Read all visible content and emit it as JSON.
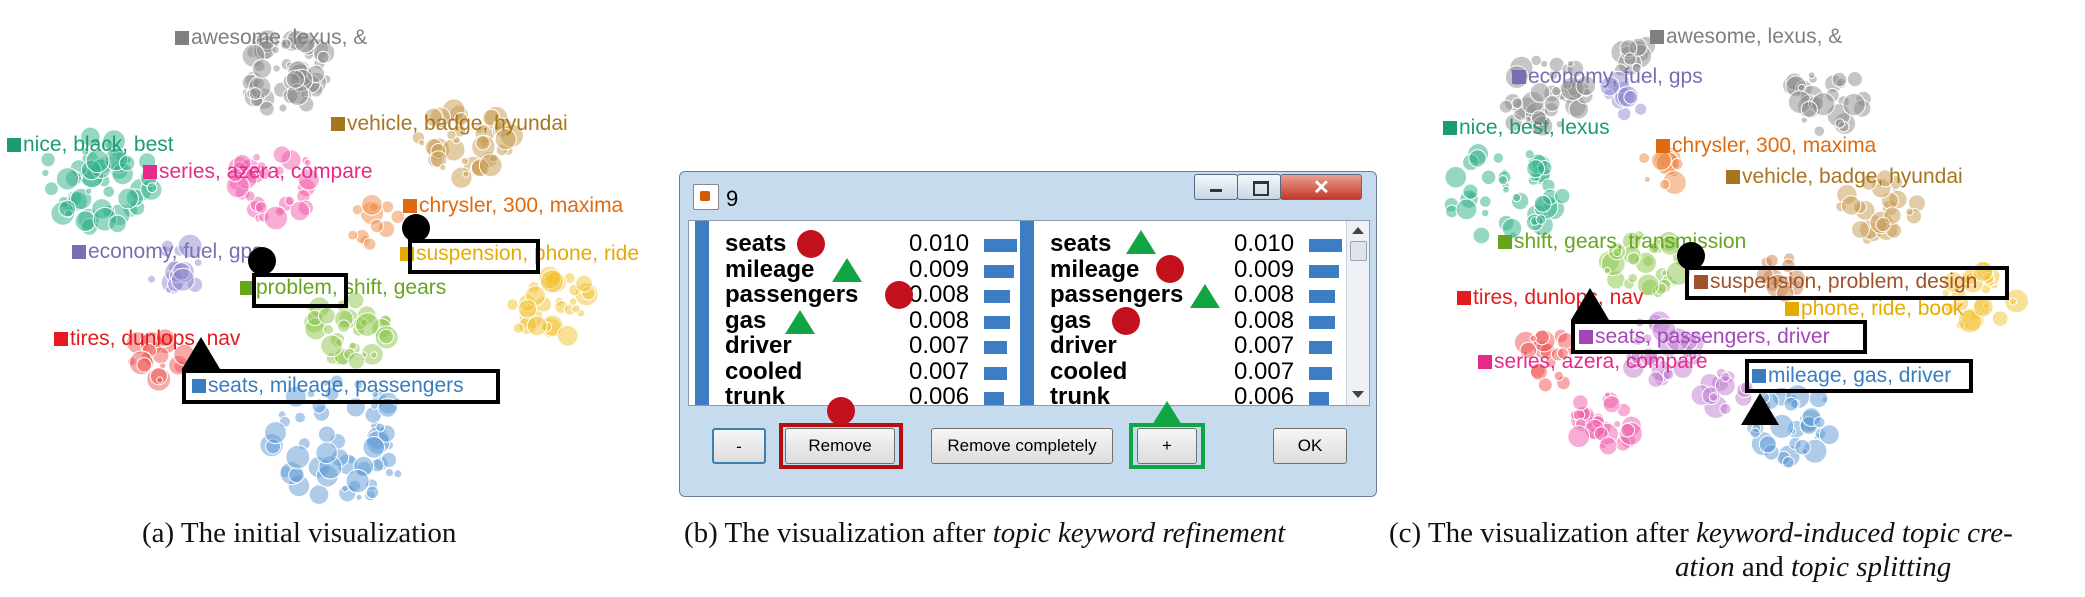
{
  "panel_a": {
    "labels": [
      {
        "text": "awesome, lexus, &",
        "color": "#7f7f7f"
      },
      {
        "text": "vehicle, badge, hyundai",
        "color": "#a8751f"
      },
      {
        "text": "nice, black, best",
        "color": "#1c9c73"
      },
      {
        "text": "series, azera, compare",
        "color": "#e7298a"
      },
      {
        "text": "chrysler, 300, maxima",
        "color": "#e06a10"
      },
      {
        "text": "economy, fuel, gps",
        "color": "#7570b3"
      },
      {
        "text": "suspension, phone, ride",
        "color": "#e6ab02"
      },
      {
        "text": "problem, shift, gears",
        "color": "#66a61e"
      },
      {
        "text": "tires, dunlops, nav",
        "color": "#e41a1c"
      },
      {
        "text": "seats, mileage, passengers",
        "color": "#3a7dc0"
      }
    ],
    "caption": "(a) The initial visualization"
  },
  "dialog": {
    "title": "9",
    "left_list": {
      "keywords": [
        "seats",
        "mileage",
        "passengers",
        "gas",
        "driver",
        "cooled",
        "trunk"
      ],
      "values": [
        "0.010",
        "0.009",
        "0.008",
        "0.008",
        "0.007",
        "0.007",
        "0.006"
      ]
    },
    "right_list": {
      "keywords": [
        "seats",
        "mileage",
        "passengers",
        "gas",
        "driver",
        "cooled",
        "trunk"
      ],
      "values": [
        "0.010",
        "0.009",
        "0.008",
        "0.008",
        "0.007",
        "0.007",
        "0.006"
      ]
    },
    "buttons": {
      "minus": "-",
      "remove": "Remove",
      "remove_completely": "Remove completely",
      "plus": "+",
      "ok": "OK"
    },
    "highlight_colors": {
      "remove": "#b50f12",
      "plus": "#12a544"
    }
  },
  "caption_b": {
    "prefix": "(b) The visualization after ",
    "italic": "topic keyword refinement"
  },
  "panel_c": {
    "labels": [
      {
        "text": "awesome, lexus, &",
        "color": "#7f7f7f"
      },
      {
        "text": "economy, fuel, gps",
        "color": "#7570b3"
      },
      {
        "text": "nice, best, lexus",
        "color": "#1c9c73"
      },
      {
        "text": "chrysler, 300, maxima",
        "color": "#e06a10"
      },
      {
        "text": "vehicle, badge, hyundai",
        "color": "#a8751f"
      },
      {
        "text": "shift, gears, transmission",
        "color": "#66a61e"
      },
      {
        "text": "suspension, problem, design",
        "color": "#a0522d"
      },
      {
        "text": "tires, dunlops, nav",
        "color": "#e41a1c"
      },
      {
        "text": "phone, ride, book",
        "color": "#e6ab02"
      },
      {
        "text": "seats, passengers, driver",
        "color": "#a347b8"
      },
      {
        "text": "series, azera, compare",
        "color": "#e7298a"
      },
      {
        "text": "mileage, gas, driver",
        "color": "#3a7dc0"
      }
    ]
  },
  "caption_c": {
    "line1_prefix": "(c) The visualization after ",
    "line1_italic": "keyword-induced topic cre-",
    "line2_italic1": "ation",
    "line2_mid": " and ",
    "line2_italic2": "topic splitting"
  }
}
